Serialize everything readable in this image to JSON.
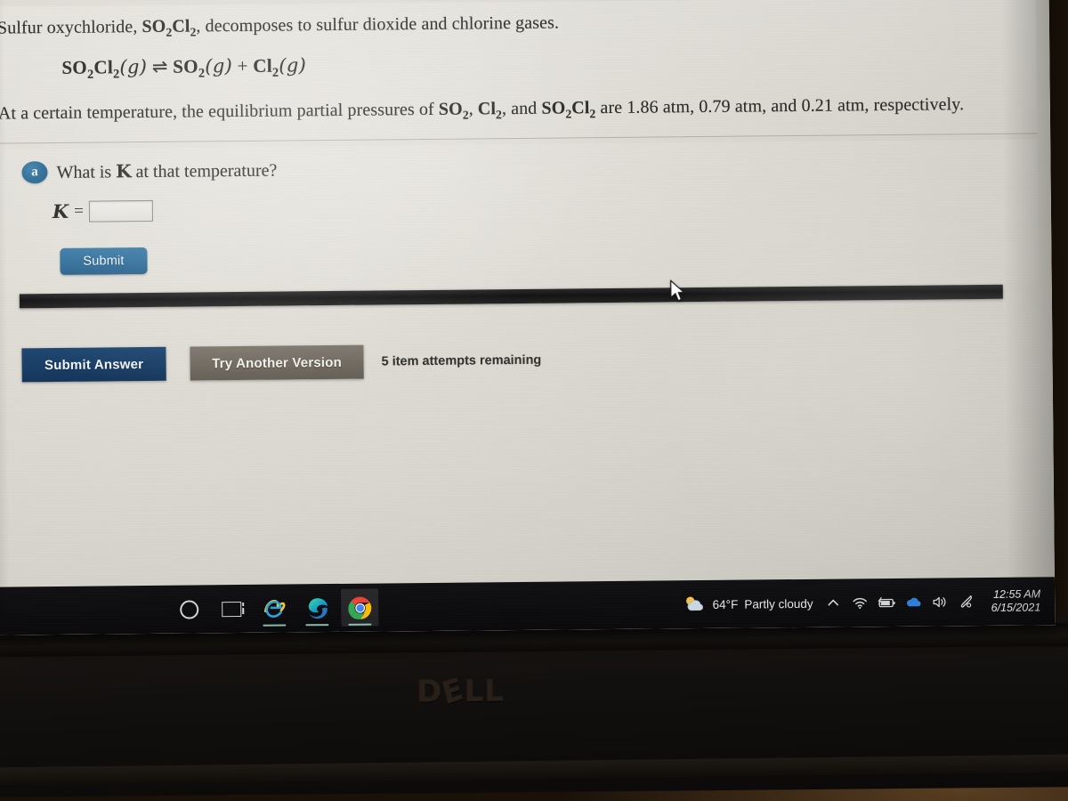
{
  "problem": {
    "line1_pre": "Sulfur oxychloride, ",
    "line1_formula": "SO2Cl2",
    "line1_post": ", decomposes to sulfur dioxide and chlorine gases.",
    "equation": "SO2Cl2(g) ⇌ SO2(g) + Cl2(g)",
    "line3": "At a certain temperature, the equilibrium partial pressures of SO2, Cl2, and SO2Cl2 are 1.86 atm, 0.79 atm, and 0.21 atm, respectively.",
    "pressures": {
      "SO2": "1.86 atm",
      "Cl2": "0.79 atm",
      "SO2Cl2": "0.21 atm"
    }
  },
  "question": {
    "badge": "a",
    "text_pre": "What is ",
    "text_var": "K",
    "text_post": " at that temperature?",
    "answer_label": "K",
    "answer_equals": "=",
    "answer_value": "",
    "answer_placeholder": "",
    "submit_label": "Submit"
  },
  "footer": {
    "submit_answer_label": "Submit Answer",
    "try_another_label": "Try Another Version",
    "attempts_text": "5 item attempts remaining"
  },
  "taskbar": {
    "items": [
      {
        "name": "cortana-icon",
        "label": "Cortana"
      },
      {
        "name": "task-view-icon",
        "label": "Task View"
      },
      {
        "name": "internet-explorer-icon",
        "label": "Internet Explorer"
      },
      {
        "name": "microsoft-edge-icon",
        "label": "Microsoft Edge"
      },
      {
        "name": "google-chrome-icon",
        "label": "Google Chrome"
      }
    ],
    "weather": {
      "temperature": "64°F",
      "condition": "Partly cloudy"
    },
    "tray": [
      {
        "name": "chevron-up-icon"
      },
      {
        "name": "wifi-icon"
      },
      {
        "name": "battery-icon"
      },
      {
        "name": "onedrive-icon"
      },
      {
        "name": "volume-icon"
      },
      {
        "name": "pen-icon"
      }
    ],
    "clock": {
      "time": "12:55 AM",
      "date": "6/15/2021"
    }
  },
  "hardware": {
    "brand": "DELL"
  },
  "colors": {
    "submit_blue": "#2f6d99",
    "submit_answer_navy": "#1a3f66",
    "try_another_gray": "#6f6960",
    "badge_blue": "#2a6b96",
    "taskbar_black": "#0a0a0c"
  }
}
